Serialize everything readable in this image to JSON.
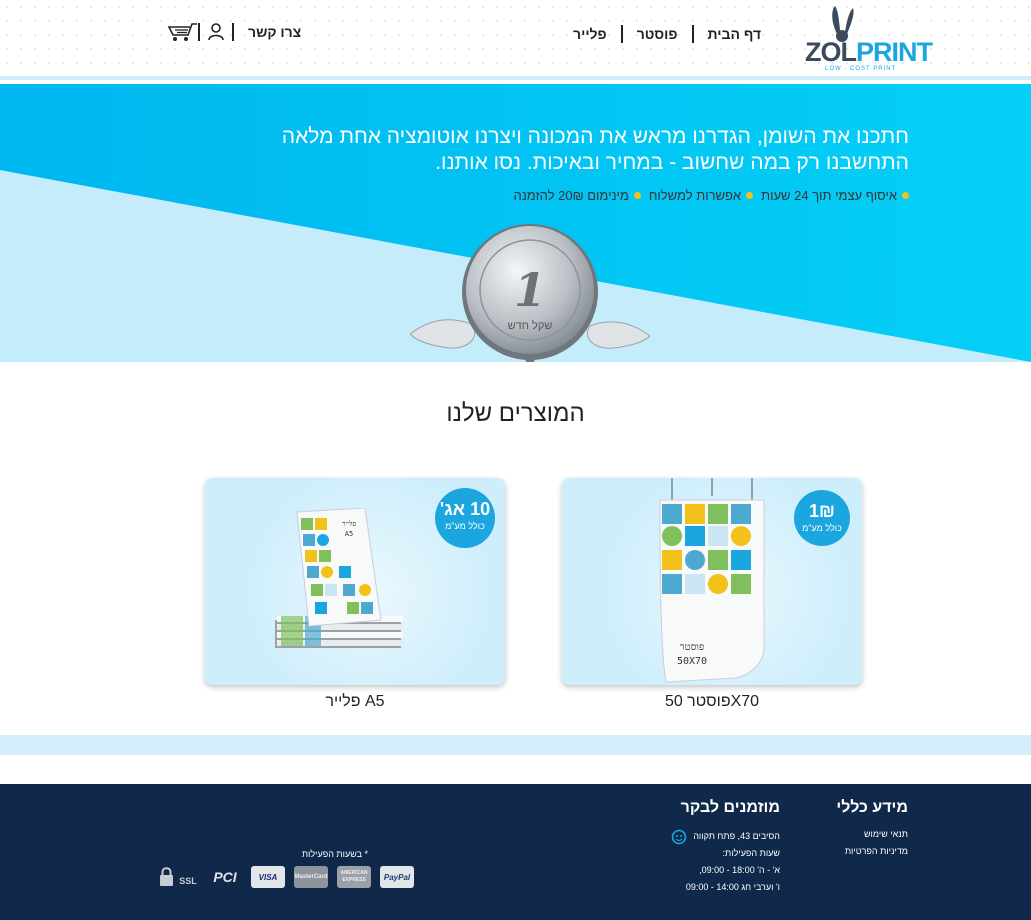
{
  "logo": {
    "zol": "ZOL",
    "print": "PRINT",
    "tagline": "LOW · COST PRINT"
  },
  "nav": {
    "items": [
      "דף הבית",
      "פוסטר",
      "פלייר"
    ],
    "contact": "צרו קשר"
  },
  "hero": {
    "line1": "חתכנו את השומן, הגדרנו מראש את המכונה ויצרנו אוטומציה אחת מלאה",
    "line2": "התחשבנו רק במה שחשוב - במחיר ובאיכות. נסו אותנו.",
    "features": [
      "איסוף עצמי תוך 24 שעות",
      "אפשרות למשלוח",
      "מינימום 20₪ להזמנה"
    ],
    "coin": {
      "value": "1",
      "text": "שקל חדש"
    }
  },
  "products": {
    "title": "המוצרים שלנו",
    "items": [
      {
        "label": "פוסטר 50X70",
        "price": "1₪",
        "vat": "כולל מע\"מ",
        "print_title": "פוסטר",
        "print_size": "50X70"
      },
      {
        "label": "פלייר A5",
        "price": "10 אג'",
        "vat": "כולל מע\"מ",
        "print_title": "פלייר",
        "print_size": "A5"
      }
    ]
  },
  "footer": {
    "general": {
      "title": "מידע כללי",
      "links": [
        "תנאי שימוש",
        "מדיניות הפרטיות"
      ]
    },
    "visit": {
      "title": "מוזמנים לבקר",
      "address": "הסיבים 43, פתח תקווה",
      "hours_title": "שעות הפעילות:",
      "hours1": "א' - ה' 18:00 - 09:00,",
      "hours2": "ו' וערבי חג 14:00 - 09:00"
    },
    "payment_note": "* בשעות הפעילות",
    "payment_methods": [
      "PayPal",
      "AMERICAN EXPRESS",
      "MasterCard",
      "VISA",
      "PCI",
      "SSL"
    ]
  },
  "colors": {
    "accent": "#1ba6e0",
    "hero_blue": "#00c2f3",
    "footer": "#10284a",
    "dot": "#f2c21b"
  }
}
